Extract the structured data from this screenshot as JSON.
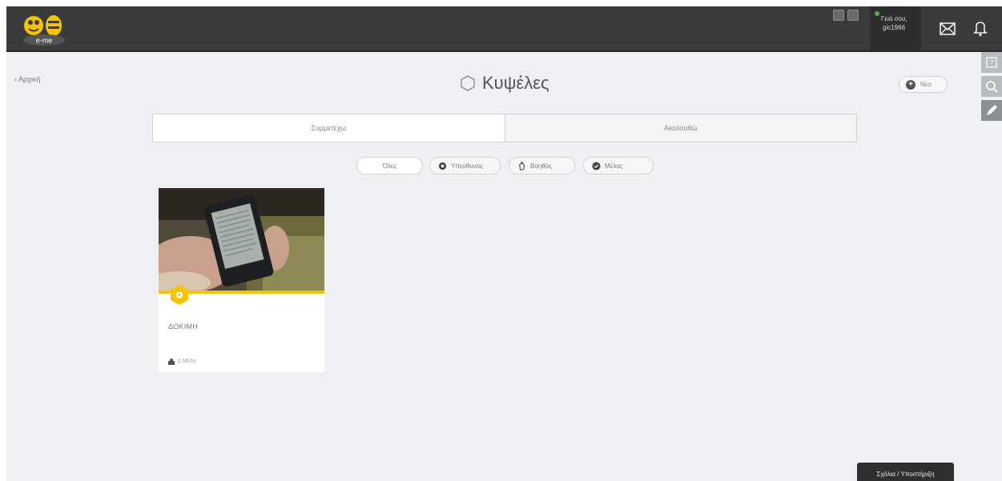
{
  "header": {
    "logo_text": "e-me",
    "user": {
      "greeting": "Γειά σου,",
      "username": "gic1966"
    }
  },
  "nav": {
    "back_label": "Αρχική"
  },
  "page": {
    "title": "Κυψέλες",
    "new_label": "Νέα"
  },
  "tabs": [
    {
      "label": "Συμμετέχω",
      "active": true
    },
    {
      "label": "Ακολουθώ",
      "active": false
    }
  ],
  "filters": [
    {
      "label": "Όλες",
      "selected": true,
      "icon": "none"
    },
    {
      "label": "Υπεύθυνος",
      "selected": false,
      "icon": "gear-icon"
    },
    {
      "label": "Βοηθός",
      "selected": false,
      "icon": "hand-icon"
    },
    {
      "label": "Μέλος",
      "selected": false,
      "icon": "check-icon"
    }
  ],
  "cards": [
    {
      "title": "ΔΟΚΙΜΗ",
      "members": "1 Μέλη",
      "accent": "#f5c400"
    }
  ],
  "footer": {
    "support_label": "Σχόλια / Υποστήριξη"
  },
  "colors": {
    "accent": "#f5c400",
    "topbar": "#3b3b3b",
    "background": "#eef0f3"
  }
}
